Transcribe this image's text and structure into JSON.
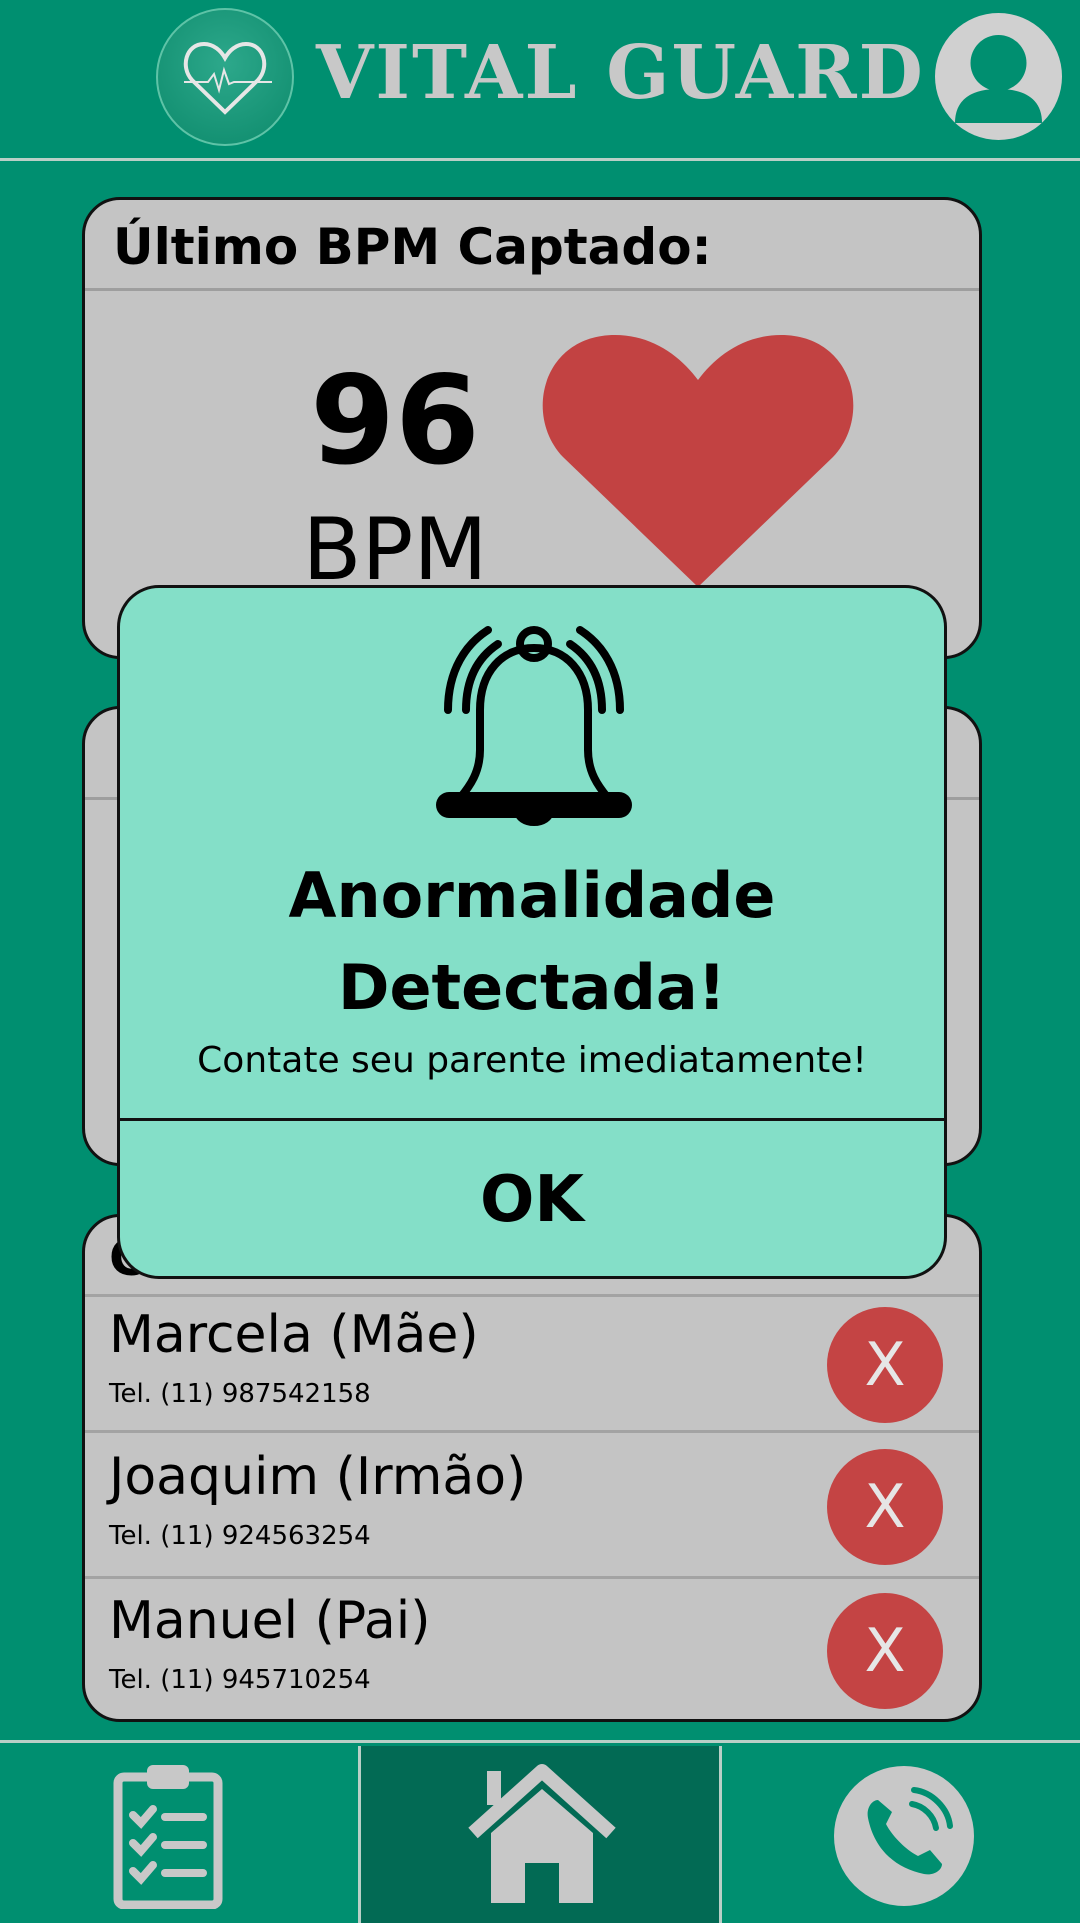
{
  "header": {
    "brand": "VITAL GUARD",
    "logo_icon": "heart-pulse-logo",
    "avatar_icon": "user-avatar-icon"
  },
  "bpm_card": {
    "title": "Último BPM Captado:",
    "value": "96",
    "unit": "BPM",
    "heart_icon": "heart-icon",
    "heart_color": "#c24242"
  },
  "contacts": {
    "title": "Contatos",
    "remove_label": "X",
    "items": [
      {
        "name": "Marcela (Mãe)",
        "tel": "Tel. (11) 987542158"
      },
      {
        "name": "Joaquim (Irmão)",
        "tel": "Tel. (11) 924563254"
      },
      {
        "name": "Manuel (Pai)",
        "tel": "Tel. (11) 945710254"
      }
    ]
  },
  "modal": {
    "icon": "bell-icon",
    "title_line1": "Anormalidade",
    "title_line2": "Detectada!",
    "message": "Contate seu parente imediatamente!",
    "ok_label": "OK"
  },
  "nav": {
    "items": [
      {
        "icon": "clipboard-checklist-icon"
      },
      {
        "icon": "home-icon",
        "active": true
      },
      {
        "icon": "phone-call-icon"
      }
    ]
  },
  "colors": {
    "background": "#008f70",
    "card": "#c4c4c4",
    "modal": "#84dfc8",
    "accent_red": "#c44444",
    "nav_active": "#026a54"
  }
}
